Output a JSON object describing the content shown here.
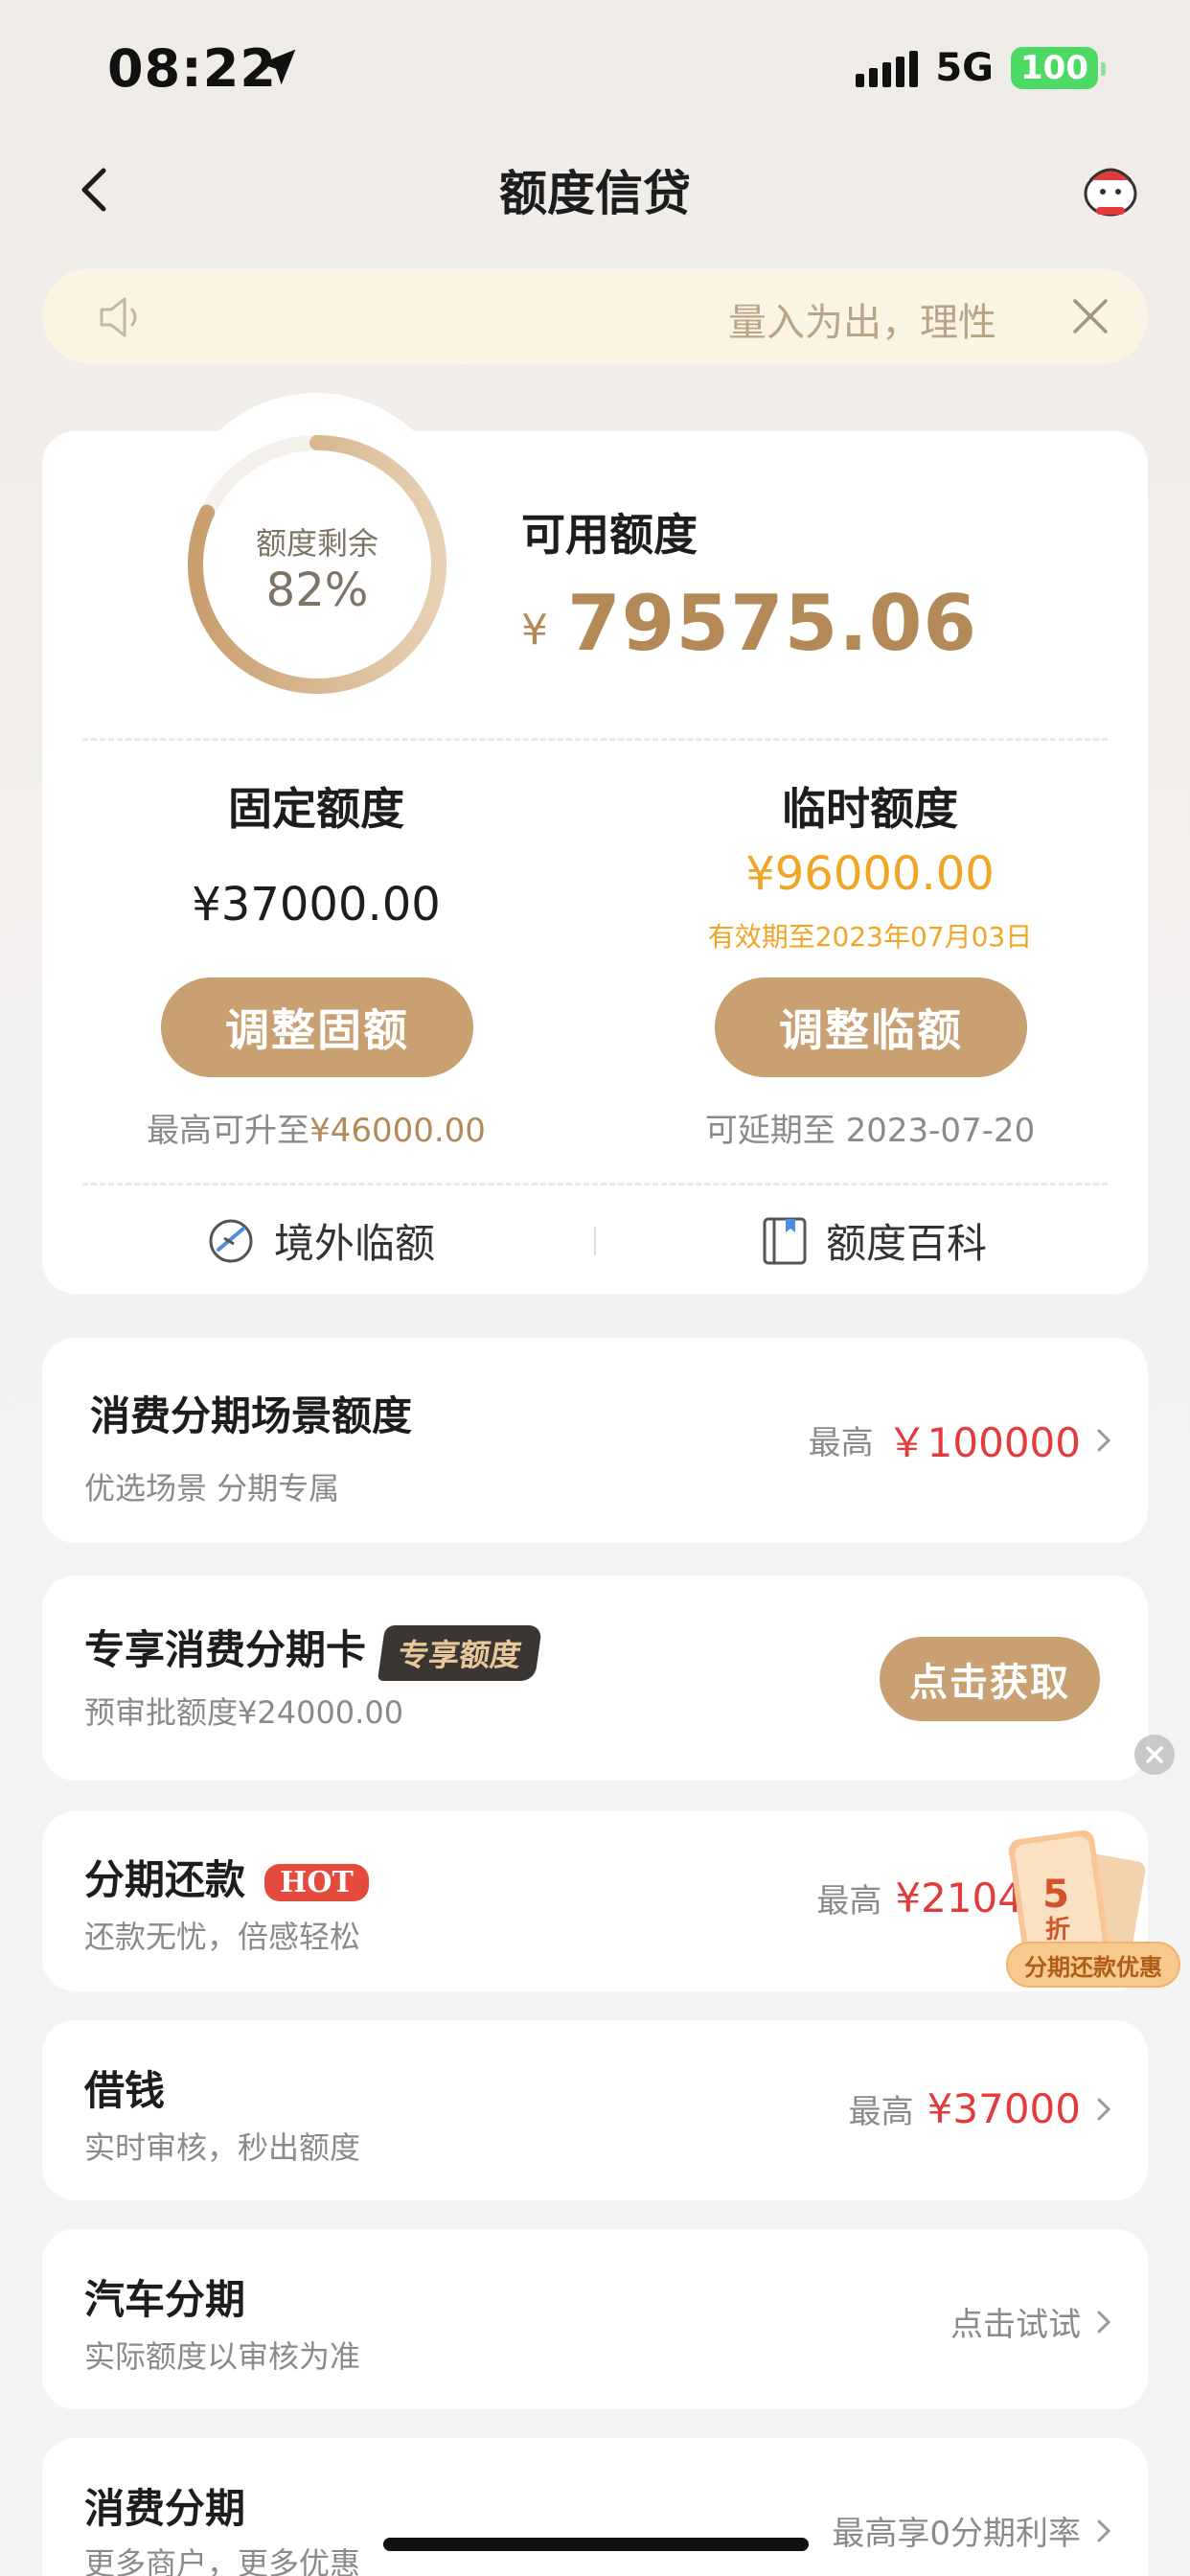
{
  "status_bar": {
    "time": "08:22",
    "network": "5G",
    "battery": "100"
  },
  "nav": {
    "title": "额度信贷"
  },
  "notice": {
    "text": "量入为出，理性"
  },
  "credit": {
    "ring_label": "额度剩余",
    "ring_percent": "82%",
    "ring_fraction": 0.82,
    "available_label": "可用额度",
    "currency_symbol": "¥",
    "available_value": "79575.06",
    "fixed": {
      "title": "固定额度",
      "value": "¥37000.00",
      "button": "调整固额",
      "note_prefix": "最高可升至",
      "note_value": "¥46000.00"
    },
    "temp": {
      "title": "临时额度",
      "value": "¥96000.00",
      "validity": "有效期至2023年07月03日",
      "button": "调整临额",
      "note": "可延期至 2023-07-20"
    },
    "links": {
      "overseas": "境外临额",
      "wiki": "额度百科"
    }
  },
  "items": {
    "scene": {
      "title": "消费分期场景额度",
      "sub": "优选场景 分期专属",
      "prefix": "最高",
      "value": "￥100000"
    },
    "card": {
      "title": "专享消费分期卡",
      "tag": "专享额度",
      "sub": "预审批额度¥24000.00",
      "button": "点击获取"
    },
    "repay": {
      "title": "分期还款",
      "badge": "HOT",
      "sub": "还款无忧，倍感轻松",
      "prefix": "最高",
      "value": "¥2104"
    },
    "borrow": {
      "title": "借钱",
      "sub": "实时审核，秒出额度",
      "prefix": "最高",
      "value": "¥37000"
    },
    "car": {
      "title": "汽车分期",
      "sub": "实际额度以审核为准",
      "right": "点击试试"
    },
    "consume": {
      "title": "消费分期",
      "sub": "更多商户，更多优惠",
      "right": "最高享0分期利率"
    }
  },
  "promo": {
    "discount": "5",
    "discount_unit": "折",
    "label": "分期还款优惠"
  },
  "colors": {
    "accent": "#c8a071",
    "gold_text": "#b38a57",
    "orange": "#f0a524",
    "red": "#e23b3b"
  }
}
